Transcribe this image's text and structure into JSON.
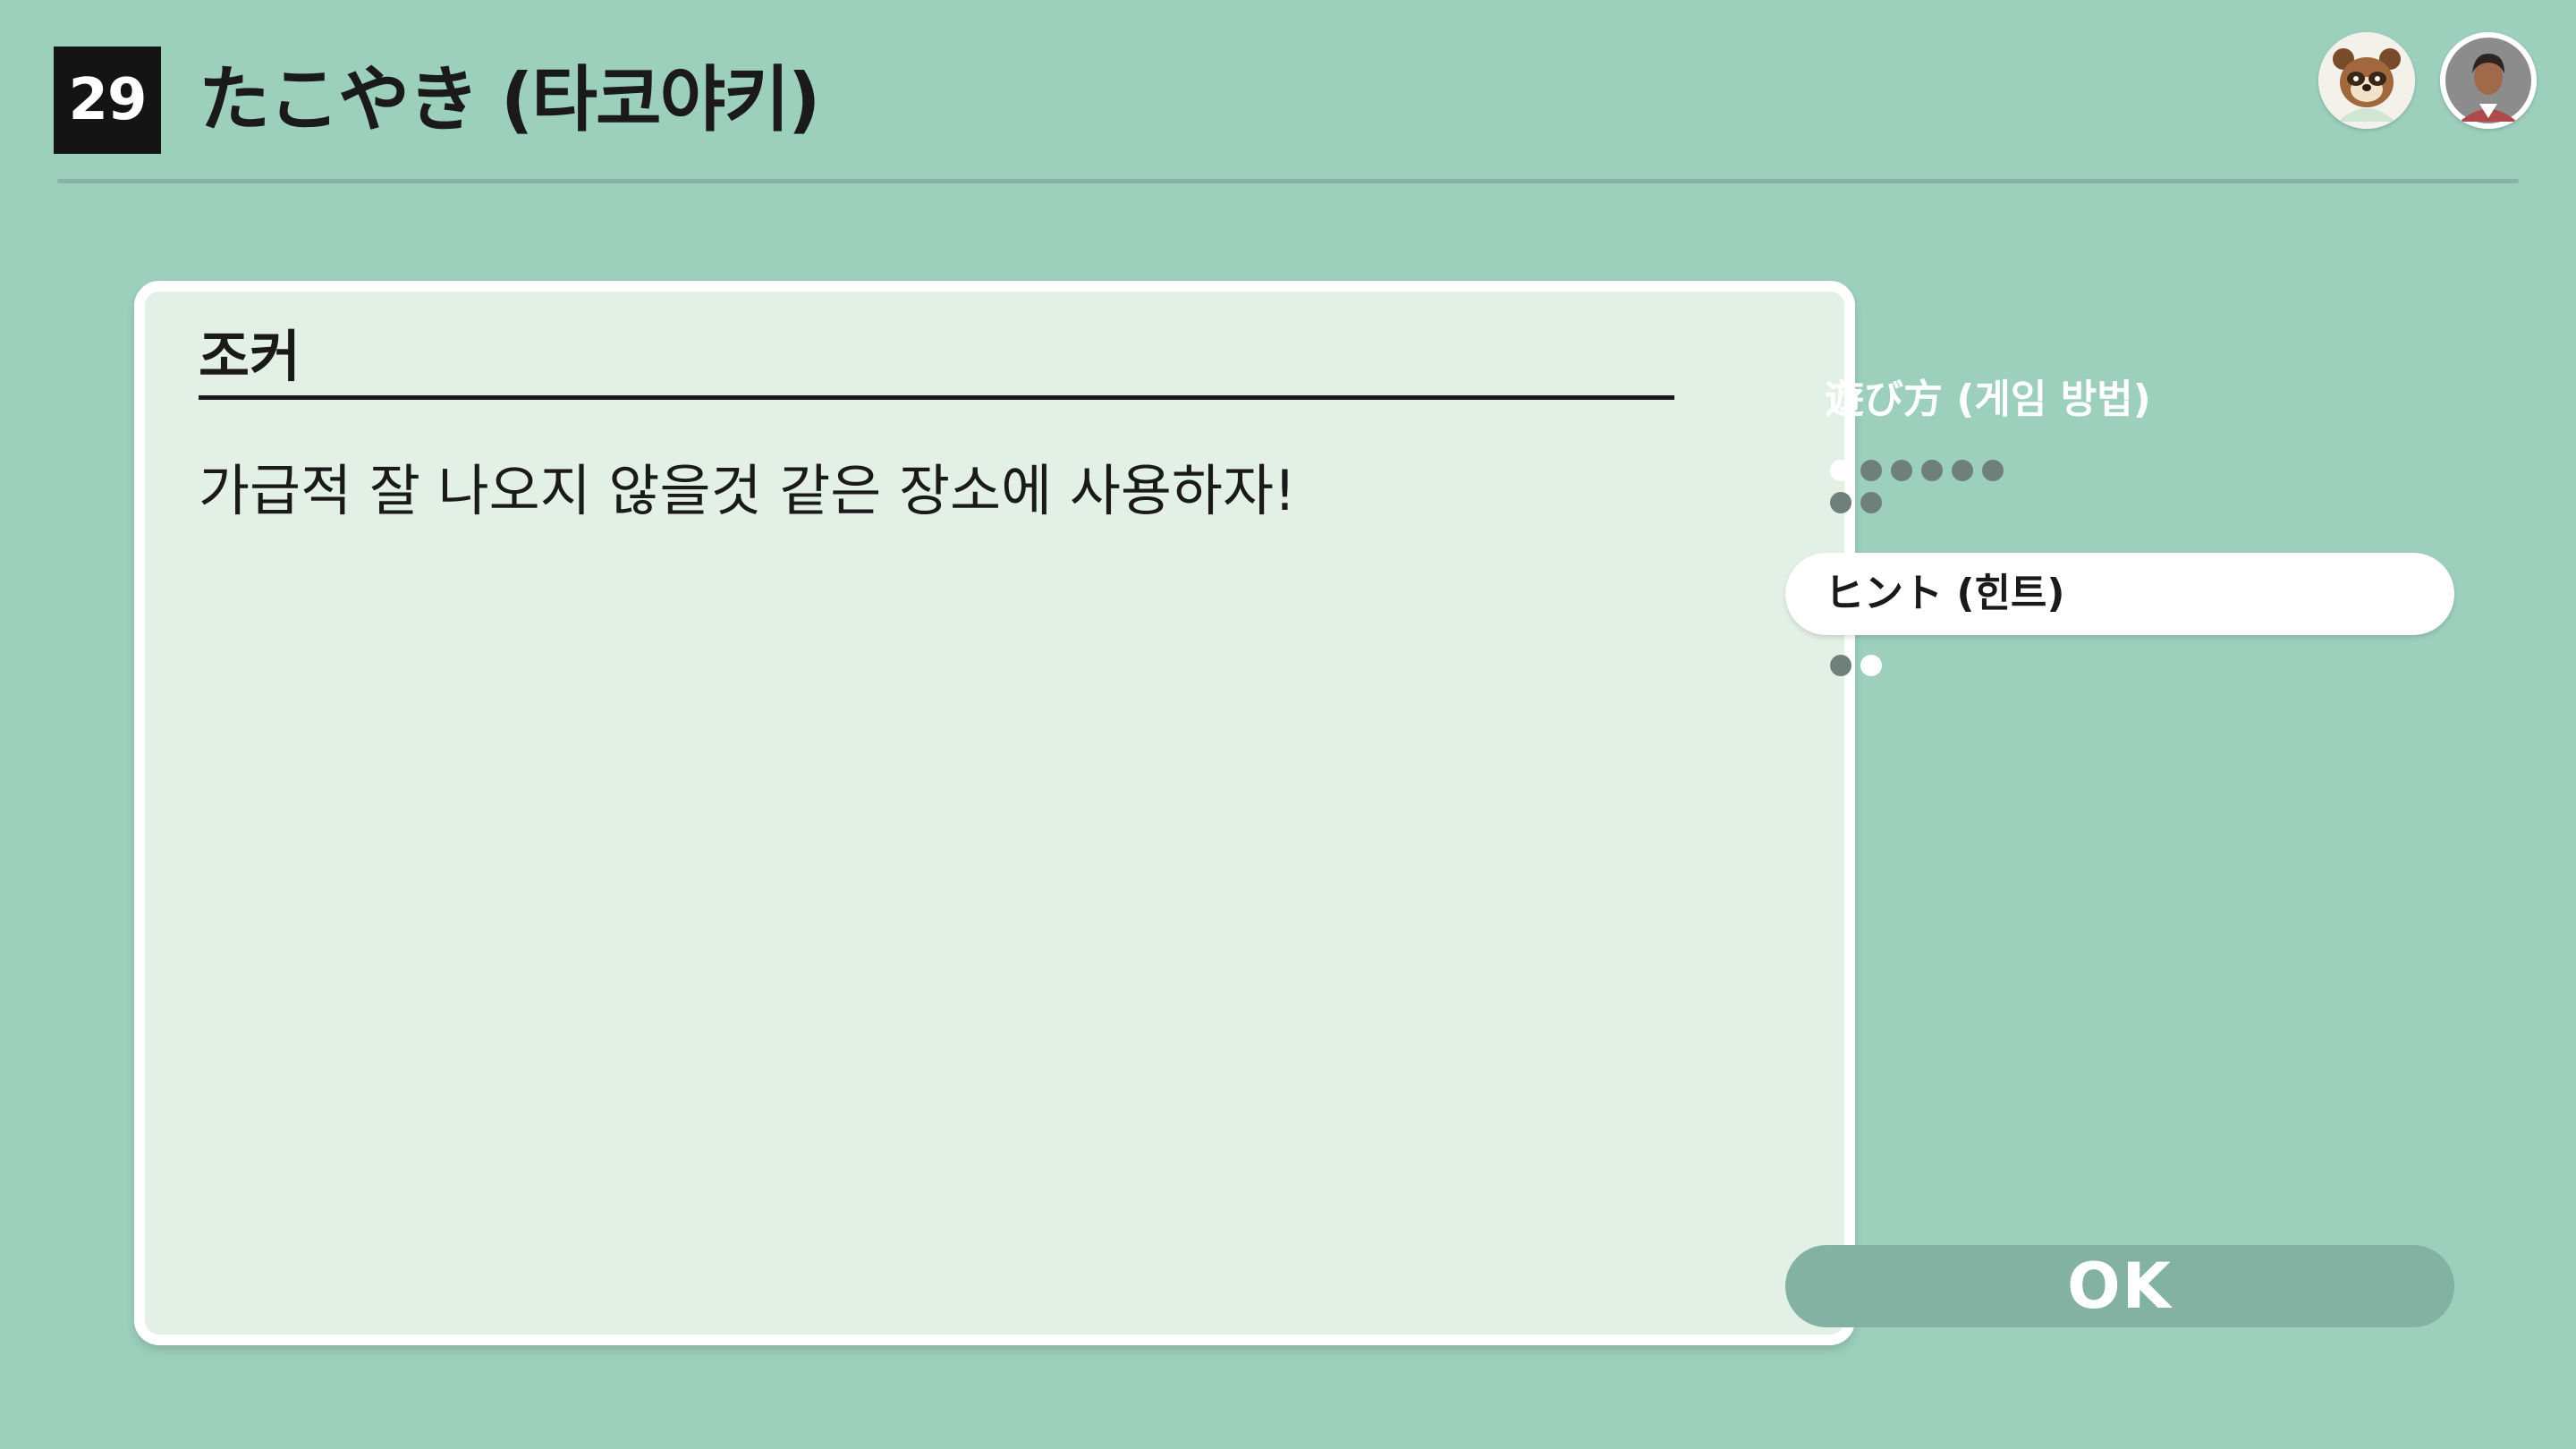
{
  "header": {
    "game_number": "29",
    "title": "たこやき (타코야키)"
  },
  "avatars": [
    {
      "icon": "tanuki-character-icon"
    },
    {
      "icon": "user-profile-icon"
    }
  ],
  "card": {
    "title": "조커",
    "body": "가급적 잘 나오지 않을것 같은 장소에 사용하자!"
  },
  "menu": {
    "how_to_play": {
      "label": "遊び方 (게임 방법)",
      "pages_total": 8,
      "page_active": 0
    },
    "hint": {
      "label": "ヒント (힌트)",
      "pages_total": 2,
      "page_active": 1
    }
  },
  "ok_button": {
    "label": "OK"
  },
  "colors": {
    "background": "#9dcfbd",
    "card_background": "#e3f0e6",
    "ok_button": "#83b2a2",
    "dot_inactive": "#6f7f79",
    "dot_active": "#ffffff"
  }
}
